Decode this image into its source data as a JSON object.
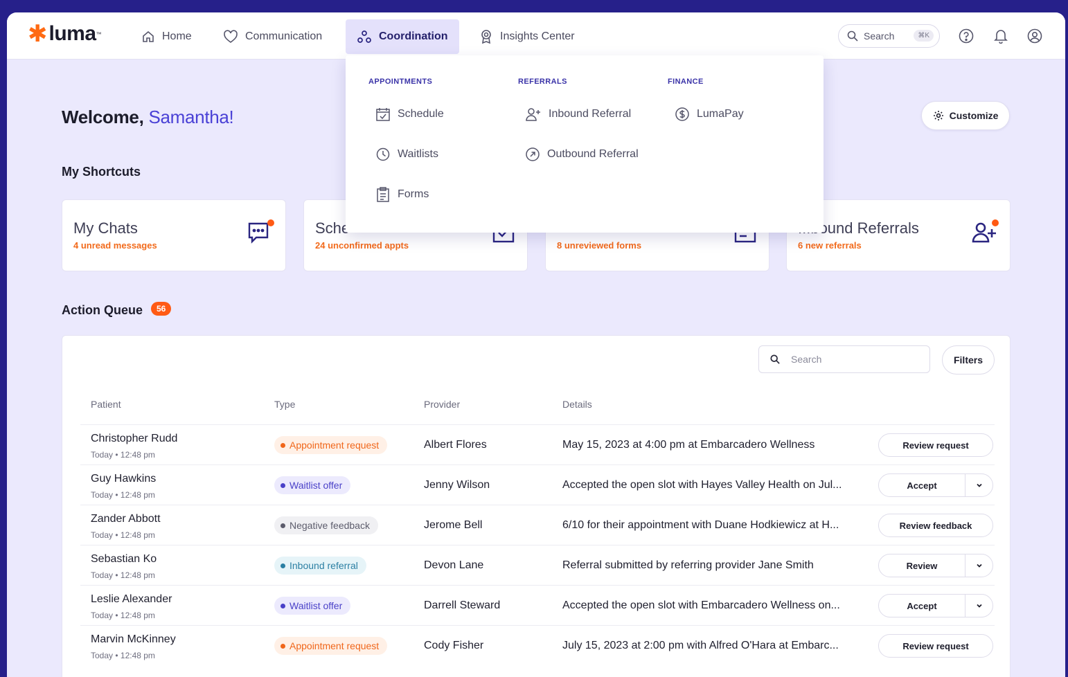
{
  "brand": {
    "logo_text": "luma",
    "accent": "#ff6a13",
    "primary": "#26208a"
  },
  "nav": {
    "items": [
      {
        "label": "Home",
        "icon": "home-icon"
      },
      {
        "label": "Communication",
        "icon": "heart-icon"
      },
      {
        "label": "Coordination",
        "icon": "coordination-icon",
        "active": true
      },
      {
        "label": "Insights Center",
        "icon": "award-icon"
      }
    ],
    "search_label": "Search",
    "search_shortcut": "⌘K"
  },
  "menu": {
    "columns": [
      {
        "heading": "APPOINTMENTS",
        "items": [
          "Schedule",
          "Waitlists",
          "Forms"
        ]
      },
      {
        "heading": "REFERRALS",
        "items": [
          "Inbound Referral",
          "Outbound Referral"
        ]
      },
      {
        "heading": "FINANCE",
        "items": [
          "LumaPay"
        ]
      }
    ]
  },
  "welcome": {
    "prefix": "Welcome,",
    "name": "Samantha!"
  },
  "customize_label": "Customize",
  "shortcuts": {
    "title": "My Shortcuts",
    "cards": [
      {
        "title": "My Chats",
        "subtitle": "4 unread messages"
      },
      {
        "title": "Sche",
        "subtitle": "24 unconfirmed appts"
      },
      {
        "title": "",
        "subtitle": "8 unreviewed forms"
      },
      {
        "title": "...bound Referrals",
        "subtitle": "6 new referrals"
      }
    ]
  },
  "queue": {
    "title": "Action Queue",
    "count": "56",
    "search_placeholder": "Search",
    "filters_label": "Filters",
    "columns": [
      "Patient",
      "Type",
      "Provider",
      "Details"
    ],
    "rows": [
      {
        "patient": "Christopher Rudd",
        "time": "Today • 12:48 pm",
        "type": "Appointment request",
        "type_color": "orange",
        "provider": "Albert Flores",
        "details": "May 15, 2023 at 4:00 pm at Embarcadero Wellness",
        "action": "Review request",
        "split": false
      },
      {
        "patient": "Guy Hawkins",
        "time": "Today • 12:48 pm",
        "type": "Waitlist offer",
        "type_color": "purple",
        "provider": "Jenny Wilson",
        "details": "Accepted the open slot with Hayes Valley Health on Jul...",
        "action": "Accept",
        "split": true
      },
      {
        "patient": "Zander Abbott",
        "time": "Today • 12:48 pm",
        "type": "Negative feedback",
        "type_color": "gray",
        "provider": "Jerome Bell",
        "details": "6/10 for their appointment with Duane Hodkiewicz at H...",
        "action": "Review feedback",
        "split": false
      },
      {
        "patient": "Sebastian Ko",
        "time": "Today • 12:48 pm",
        "type": "Inbound referral",
        "type_color": "cyan",
        "provider": "Devon Lane",
        "details": "Referral submitted by referring provider Jane Smith",
        "action": "Review",
        "split": true
      },
      {
        "patient": "Leslie Alexander",
        "time": "Today • 12:48 pm",
        "type": "Waitlist offer",
        "type_color": "purple",
        "provider": "Darrell Steward",
        "details": "Accepted the open slot with Embarcadero Wellness on...",
        "action": "Accept",
        "split": true
      },
      {
        "patient": "Marvin McKinney",
        "time": "Today • 12:48 pm",
        "type": "Appointment request",
        "type_color": "orange",
        "provider": "Cody Fisher",
        "details": "July 15, 2023 at 2:00 pm with Alfred O'Hara at Embarc...",
        "action": "Review request",
        "split": false
      }
    ]
  }
}
